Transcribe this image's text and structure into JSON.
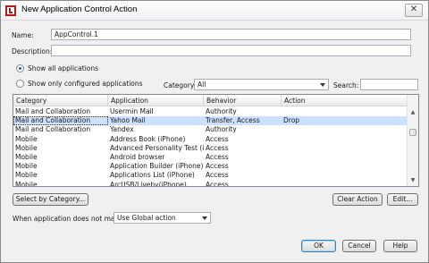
{
  "window": {
    "title": "New Application Control Action",
    "close_glyph": "✕"
  },
  "form": {
    "name_label": "Name:",
    "name_value": "AppControl.1",
    "description_label": "Description:",
    "description_value": ""
  },
  "filters": {
    "show_all_label": "Show all applications",
    "show_configured_label": "Show only configured applications",
    "selected": "show_all",
    "category_label": "Category:",
    "category_value": "All",
    "search_label": "Search:",
    "search_value": ""
  },
  "grid": {
    "columns": [
      "Category",
      "Application",
      "Behavior",
      "Action"
    ],
    "rows": [
      {
        "category": "Mail and Collaboration",
        "application": "Usermin Mail",
        "behavior": "Authority",
        "action": ""
      },
      {
        "category": "Mail and Collaboration",
        "application": "Yahoo Mail",
        "behavior": "Transfer, Access",
        "action": "Drop"
      },
      {
        "category": "Mail and Collaboration",
        "application": "Yandex",
        "behavior": "Authority",
        "action": ""
      },
      {
        "category": "Mobile",
        "application": "Address Book (iPhone)",
        "behavior": "Access",
        "action": ""
      },
      {
        "category": "Mobile",
        "application": "Advanced Personality Test (iPh...",
        "behavior": "Access",
        "action": ""
      },
      {
        "category": "Mobile",
        "application": "Android browser",
        "behavior": "Access",
        "action": ""
      },
      {
        "category": "Mobile",
        "application": "Application Builder (iPhone)",
        "behavior": "Access",
        "action": ""
      },
      {
        "category": "Mobile",
        "application": "Applications List (iPhone)",
        "behavior": "Access",
        "action": ""
      },
      {
        "category": "Mobile",
        "application": "ArcUSB/Liveby(iPhone)",
        "behavior": "Access",
        "action": ""
      }
    ],
    "selected_row": 1
  },
  "buttons": {
    "select_by_category": "Select by Category...",
    "clear_action": "Clear Action",
    "edit": "Edit...",
    "ok": "OK",
    "cancel": "Cancel",
    "help": "Help"
  },
  "no_match": {
    "label": "When application does not match:",
    "value": "Use Global action"
  },
  "icons": {
    "app_icon": "watchguard-icon",
    "sort_up": "scroll-up-icon",
    "sort_down": "scroll-down-icon"
  }
}
